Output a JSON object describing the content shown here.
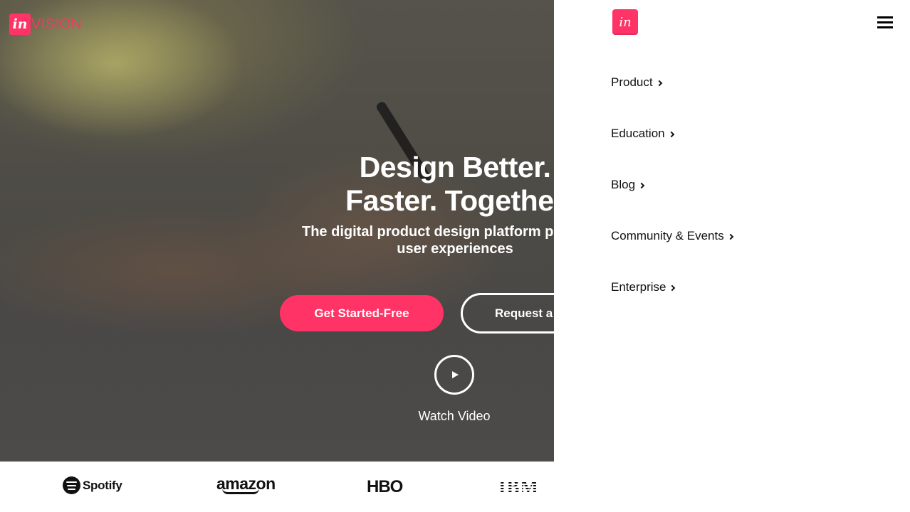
{
  "brand": {
    "logo_mark": "in",
    "logo_word": "VISION",
    "accent_color": "#ff3366"
  },
  "hero": {
    "headline_line1": "Design Better.",
    "headline_line2": "Faster. Together",
    "subhead_line1": "The digital product design platform powering",
    "subhead_line2": "user experiences",
    "primary_cta": "Get Started-Free",
    "secondary_cta": "Request a",
    "play_icon": "play-icon",
    "watch_video": "Watch Video"
  },
  "customers": {
    "spotify": "Spotify",
    "amazon": "amazon",
    "hbo": "HBO",
    "ibm": "IBM"
  },
  "nav_panel": {
    "logo_mark": "in",
    "menu_icon": "hamburger-icon",
    "items": [
      {
        "label": "Product"
      },
      {
        "label": "Education"
      },
      {
        "label": "Blog"
      },
      {
        "label": "Community & Events"
      },
      {
        "label": "Enterprise"
      }
    ]
  }
}
